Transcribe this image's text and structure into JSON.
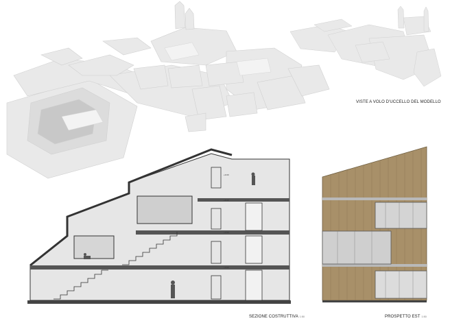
{
  "captions": {
    "aerial": "VISTE A VOLO D'UCCELLO DEL MODELLO",
    "section": "SEZIONE COSTRUTTIVA",
    "section_scale": "1:50",
    "facade": "PROSPETTO EST",
    "facade_scale": "1:50"
  },
  "colors": {
    "model": "#e8e8e8",
    "model_shadow": "#cfcfcf",
    "section_fill": "#e6e6e6",
    "section_dark": "#3a3a3a",
    "wood": "#a89069",
    "glass": "#c9c9c9"
  }
}
